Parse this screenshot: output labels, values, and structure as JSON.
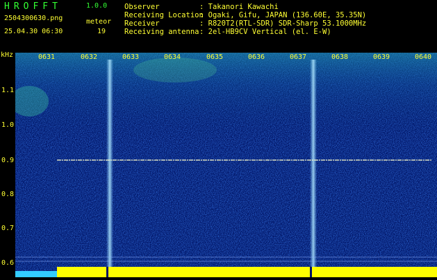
{
  "header": {
    "app_name": "HROFFT",
    "version": "1.0.0",
    "filename": "2504300630.png",
    "datetime": "25.04.30 06:30",
    "meteor_label": "meteor",
    "meteor_count": "19",
    "info": [
      {
        "label": "Observer",
        "value": ": Takanori Kawachi"
      },
      {
        "label": "Receiving Location",
        "value": ": Ogaki, Gifu, JAPAN (136.60E, 35.35N)"
      },
      {
        "label": "Receiver",
        "value": ": R820T2(RTL-SDR) SDR-Sharp 53.1000MHz"
      },
      {
        "label": "Receiving antenna",
        "value": ": 2el-HB9CV Vertical (el. E-W)"
      }
    ]
  },
  "axis": {
    "unit": "kHz",
    "y_ticks": [
      "1.1",
      "1.0",
      "0.9",
      "0.8",
      "0.7",
      "0.6"
    ],
    "time_ticks": [
      "0631",
      "0632",
      "0633",
      "0634",
      "0635",
      "0636",
      "0637",
      "0638",
      "0639",
      "0640"
    ]
  },
  "colors": {
    "background": "#001466",
    "text": "#ffff33",
    "title": "#33ff33",
    "tone_line": "#ffffcc",
    "level_bar": "#ffff00",
    "level_bar_start": "#33ccff"
  }
}
